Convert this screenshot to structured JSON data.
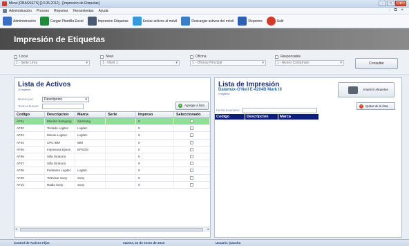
{
  "window": {
    "title": "Menu [OBASSETS] [13.06.2012] - [Impresion de Etiquetas]",
    "controls": [
      "-",
      "□",
      "x"
    ]
  },
  "menu": {
    "items": [
      "Administración",
      "Proceso",
      "Reportes",
      "Herramientas",
      "Ayuda"
    ],
    "mdi_controls": "- ⧉ ×"
  },
  "toolbar": {
    "items": [
      {
        "label": "Administración",
        "icon": "admin-icon",
        "color": "#3b6fc4"
      },
      {
        "label": "Cargar Plantilla Excel",
        "icon": "excel-icon",
        "color": "#1f8a3a"
      },
      {
        "label": "Impresion Etiquetas",
        "icon": "printer-icon",
        "color": "#4a5a72"
      },
      {
        "label": "Enviar activos al móvil",
        "icon": "send-mobile-icon",
        "color": "#3a9ad9"
      },
      {
        "label": "Descargar activos del móvil",
        "icon": "download-mobile-icon",
        "color": "#3a7dc9"
      },
      {
        "label": "Reportes",
        "icon": "reports-icon",
        "color": "#2e5fb0"
      },
      {
        "label": "Salir",
        "icon": "exit-icon",
        "color": "#d23a2a"
      }
    ]
  },
  "banner": {
    "title": "Impresión de Etiquetas"
  },
  "filters": {
    "local": {
      "label": "Local",
      "value": "1 - Sede Lima"
    },
    "nivel": {
      "label": "Nivel",
      "value": "1 - Nivel 1"
    },
    "oficina": {
      "label": "Oficina",
      "value": "1 - Oficina Principal"
    },
    "responsable": {
      "label": "Responsable",
      "value": "1 - Alvaro Costamalo"
    },
    "consult_label": "Consultar"
  },
  "activos": {
    "title": "Lista de Activos",
    "count": "10 registros",
    "search_label": "Buscar por:",
    "search_field": "Descripcion",
    "text_label": "Texto a buscar:",
    "add_label": "Agregar a lista",
    "columns": [
      "Codigo",
      "Descripcion",
      "Marca",
      "Serie",
      "Impreso",
      "Seleccionado"
    ],
    "rows": [
      {
        "codigo": "AF01",
        "descripcion": "Monitor Samgung",
        "marca": "Samsung",
        "serie": "",
        "impreso": "0",
        "selected": true
      },
      {
        "codigo": "AF02",
        "descripcion": "Teclado Logitec",
        "marca": "Logitec",
        "serie": "",
        "impreso": "0",
        "selected": false
      },
      {
        "codigo": "AF03",
        "descripcion": "Mouse Logitec",
        "marca": "Logitec",
        "serie": "",
        "impreso": "0",
        "selected": false
      },
      {
        "codigo": "AF04",
        "descripcion": "CPU IBM",
        "marca": "IBM",
        "serie": "",
        "impreso": "0",
        "selected": false
      },
      {
        "codigo": "AF05",
        "descripcion": "Impresora Epson",
        "marca": "EPSON",
        "serie": "",
        "impreso": "0",
        "selected": false
      },
      {
        "codigo": "AF06",
        "descripcion": "Silla Giratoria",
        "marca": "",
        "serie": "",
        "impreso": "0",
        "selected": false
      },
      {
        "codigo": "AF07",
        "descripcion": "Silla Giratoria",
        "marca": "",
        "serie": "",
        "impreso": "0",
        "selected": false
      },
      {
        "codigo": "AF08",
        "descripcion": "Parlantes Logitec",
        "marca": "Logitec",
        "serie": "",
        "impreso": "0",
        "selected": false
      },
      {
        "codigo": "AF09",
        "descripcion": "Televisor Sony",
        "marca": "Sony",
        "serie": "",
        "impreso": "0",
        "selected": false
      },
      {
        "codigo": "AF10",
        "descripcion": "Radio Sony",
        "marca": "Sony",
        "serie": "",
        "impreso": "0",
        "selected": false
      }
    ]
  },
  "impresion": {
    "title": "Lista de Impresión",
    "printer": "Datamax-O'Neil E-4204B Mark III",
    "count": "0 registros",
    "print_label": "Imprimir etiquetas",
    "date_label": "Fecha Inventario:",
    "remove_label": "Quitar de la lista",
    "columns": [
      "Codigo",
      "Descripcion",
      "Marca"
    ]
  },
  "status": {
    "app": "Control de Activos Fijos",
    "date": "martes, 22 de enero de 2013",
    "user": "Usuario: jsancho"
  }
}
